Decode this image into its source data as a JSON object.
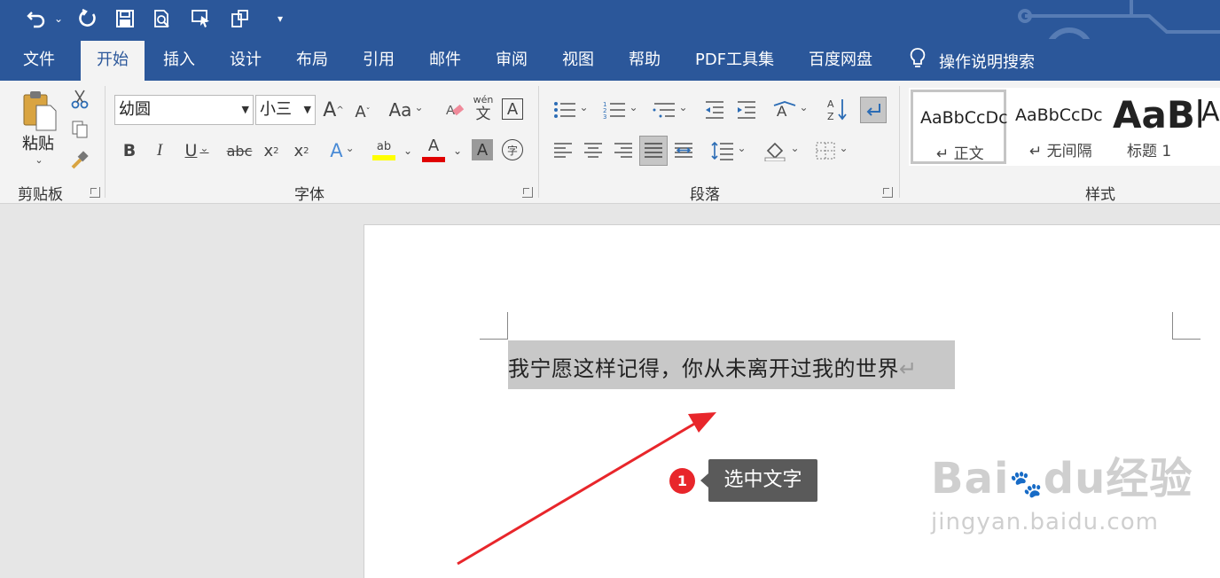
{
  "tabs": [
    "文件",
    "开始",
    "插入",
    "设计",
    "布局",
    "引用",
    "邮件",
    "审阅",
    "视图",
    "帮助",
    "PDF工具集",
    "百度网盘"
  ],
  "active_tab": "开始",
  "tell_me": "操作说明搜索",
  "clipboard": {
    "paste": "粘贴",
    "label": "剪贴板"
  },
  "font": {
    "name": "幼圆",
    "size": "小三",
    "label": "字体",
    "aa": "Aa",
    "wen": "wén",
    "wen_char": "文",
    "char_border": "A",
    "b": "B",
    "i": "I",
    "u": "U",
    "strike": "abc",
    "sub": "x",
    "sub_2": "2",
    "sup": "x",
    "sup_2": "2",
    "font_color": "A",
    "shade": "A",
    "enclose": "字",
    "effects": "A",
    "highlight": "ab"
  },
  "paragraph": {
    "label": "段落"
  },
  "styles": {
    "label": "样式",
    "items": [
      {
        "sample": "AaBbCcDc",
        "name": "↵ 正文"
      },
      {
        "sample": "AaBbCcDc",
        "name": "↵ 无间隔"
      },
      {
        "sample": "AaBl",
        "name": "标题 1"
      },
      {
        "sample": "A",
        "name": ""
      }
    ]
  },
  "document": {
    "text": "我宁愿这样记得，你从未离开过我的世界",
    "pilcrow": "↵"
  },
  "annotation": {
    "badge": "1",
    "callout": "选中文字"
  },
  "watermark": {
    "brand": "Bai",
    "du": "du",
    "jy": "经验",
    "url": "jingyan.baidu.com"
  },
  "colors": {
    "word_blue": "#2b579a",
    "arrow_red": "#e8262b"
  }
}
